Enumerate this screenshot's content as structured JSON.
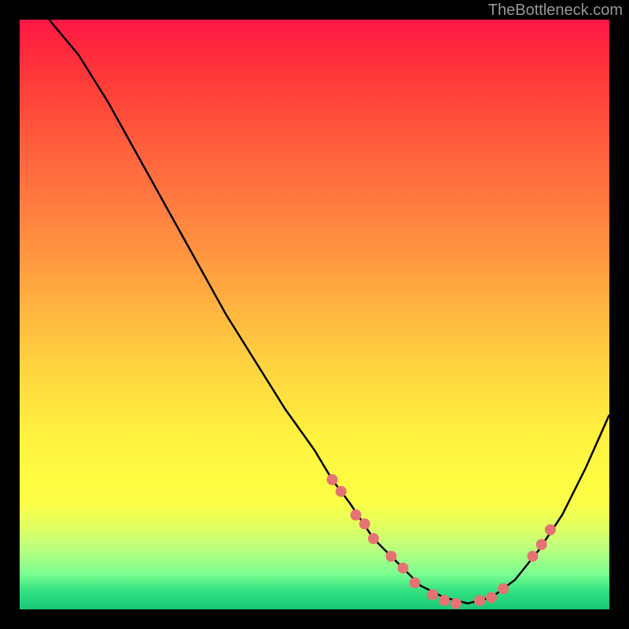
{
  "watermark": "TheBottleneck.com",
  "chart_data": {
    "type": "line",
    "title": "",
    "xlabel": "",
    "ylabel": "",
    "xlim": [
      0,
      100
    ],
    "ylim": [
      0,
      100
    ],
    "curve": {
      "x": [
        5,
        10,
        15,
        20,
        25,
        30,
        35,
        40,
        45,
        50,
        53,
        56,
        60,
        64,
        68,
        72,
        76,
        80,
        84,
        88,
        92,
        96,
        100
      ],
      "y": [
        100,
        94,
        86,
        77,
        68,
        59,
        50,
        42,
        34,
        27,
        22,
        18,
        12,
        8,
        4,
        2,
        1,
        2,
        5,
        10,
        16,
        24,
        33
      ]
    },
    "markers": [
      {
        "x": 53,
        "y": 22
      },
      {
        "x": 54.5,
        "y": 20
      },
      {
        "x": 57,
        "y": 16
      },
      {
        "x": 58.5,
        "y": 14.5
      },
      {
        "x": 60,
        "y": 12
      },
      {
        "x": 63,
        "y": 9
      },
      {
        "x": 65,
        "y": 7
      },
      {
        "x": 67,
        "y": 4.5
      },
      {
        "x": 70,
        "y": 2.5
      },
      {
        "x": 72,
        "y": 1.5
      },
      {
        "x": 74,
        "y": 1
      },
      {
        "x": 78,
        "y": 1.5
      },
      {
        "x": 80,
        "y": 2
      },
      {
        "x": 82,
        "y": 3.5
      },
      {
        "x": 87,
        "y": 9
      },
      {
        "x": 88.5,
        "y": 11
      },
      {
        "x": 90,
        "y": 13.5
      }
    ],
    "marker_color": "#e57373",
    "curve_color": "#000000"
  }
}
